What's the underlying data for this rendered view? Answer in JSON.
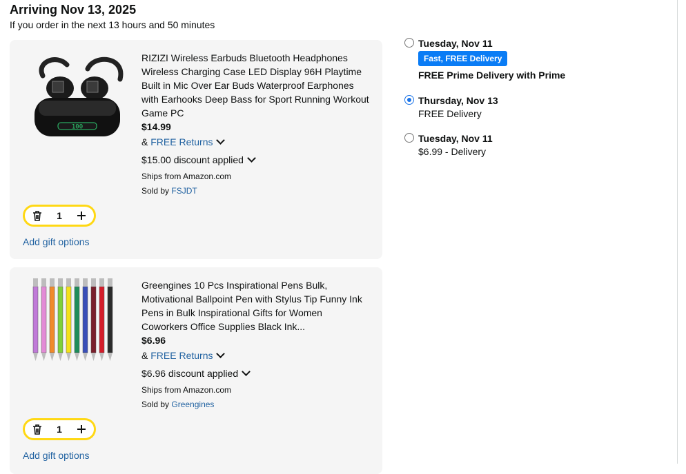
{
  "header": {
    "title": "Arriving Nov 13, 2025",
    "subtitle": "If you order in the next 13 hours and 50 minutes"
  },
  "items": [
    {
      "name": "RIZIZI Wireless Earbuds Bluetooth Headphones Wireless Charging Case LED Display 96H Playtime Built in Mic Over Ear Buds Waterproof Earphones with Earhooks Deep Bass for Sport Running Workout Game PC",
      "price": "$14.99",
      "returns_prefix": "&",
      "returns_link": "FREE Returns",
      "discount": "$15.00 discount applied",
      "ships_from": "Ships from Amazon.com",
      "sold_by_prefix": "Sold by",
      "seller": "FSJDT",
      "quantity": "1",
      "gift_link": "Add gift options",
      "image_icon": "earbuds-product-image"
    },
    {
      "name": "Greengines 10 Pcs Inspirational Pens Bulk, Motivational Ballpoint Pen with Stylus Tip Funny Ink Pens in Bulk Inspirational Gifts for Women Coworkers Office Supplies Black Ink...",
      "price": "$6.96",
      "returns_prefix": "&",
      "returns_link": "FREE Returns",
      "discount": "$6.96 discount applied",
      "ships_from": "Ships from Amazon.com",
      "sold_by_prefix": "Sold by",
      "seller": "Greengines",
      "quantity": "1",
      "gift_link": "Add gift options",
      "image_icon": "pens-product-image"
    }
  ],
  "delivery_options": [
    {
      "date": "Tuesday, Nov 11",
      "badge": "Fast, FREE Delivery",
      "detail": "FREE Prime Delivery with Prime",
      "selected": false
    },
    {
      "date": "Thursday, Nov 13",
      "detail": "FREE Delivery",
      "selected": true
    },
    {
      "date": "Tuesday, Nov 11",
      "detail": "$6.99 - Delivery",
      "selected": false
    }
  ],
  "colors": {
    "link": "#2162a1",
    "stepper_border": "#ffd814",
    "badge_bg": "#0a7cf5",
    "card_bg": "#f5f5f5"
  }
}
